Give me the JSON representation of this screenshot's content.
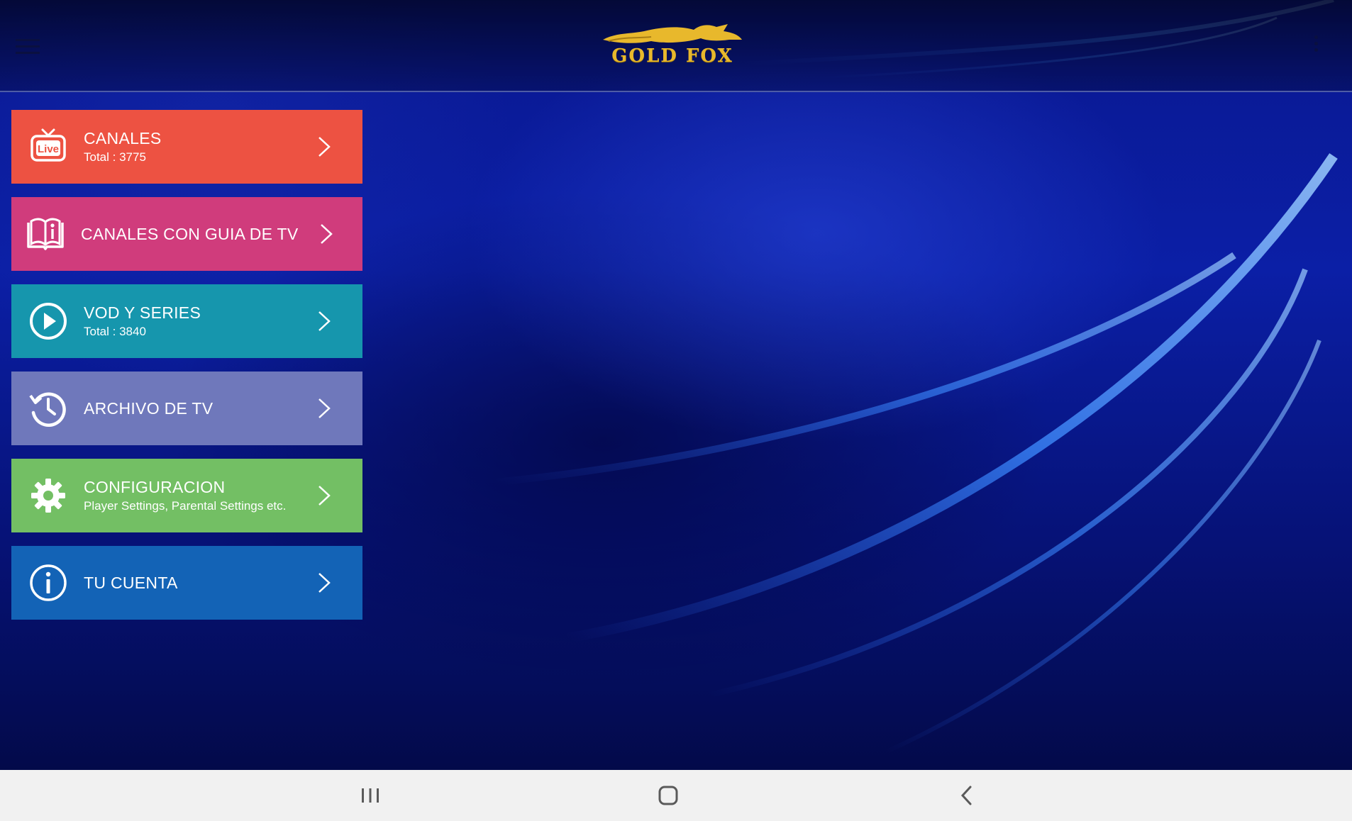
{
  "app": {
    "logo_text": "GOLD FOX"
  },
  "menu": {
    "items": [
      {
        "id": "canales",
        "title": "CANALES",
        "subtitle": "Total : 3775",
        "icon": "live-tv-icon",
        "color": "#ed5242"
      },
      {
        "id": "guia",
        "title": "CANALES CON GUIA DE TV",
        "subtitle": "",
        "icon": "book-info-icon",
        "color": "#d03c7c"
      },
      {
        "id": "vod",
        "title": "VOD Y SERIES",
        "subtitle": "Total : 3840",
        "icon": "play-circle-icon",
        "color": "#1696ad"
      },
      {
        "id": "archivo",
        "title": "ARCHIVO DE TV",
        "subtitle": "",
        "icon": "history-icon",
        "color": "#6f78bb"
      },
      {
        "id": "config",
        "title": "CONFIGURACION",
        "subtitle": "Player Settings, Parental Settings etc.",
        "icon": "gear-icon",
        "color": "#73bf64"
      },
      {
        "id": "cuenta",
        "title": "TU CUENTA",
        "subtitle": "",
        "icon": "info-circle-icon",
        "color": "#1363b6"
      }
    ]
  },
  "colors": {
    "logo_gold": "#e8b82c",
    "background_blue": "#0b1fa6",
    "navbar": "#f1f1f1"
  },
  "system_nav": {
    "icons": [
      "recent-apps-icon",
      "home-icon",
      "back-icon"
    ]
  }
}
